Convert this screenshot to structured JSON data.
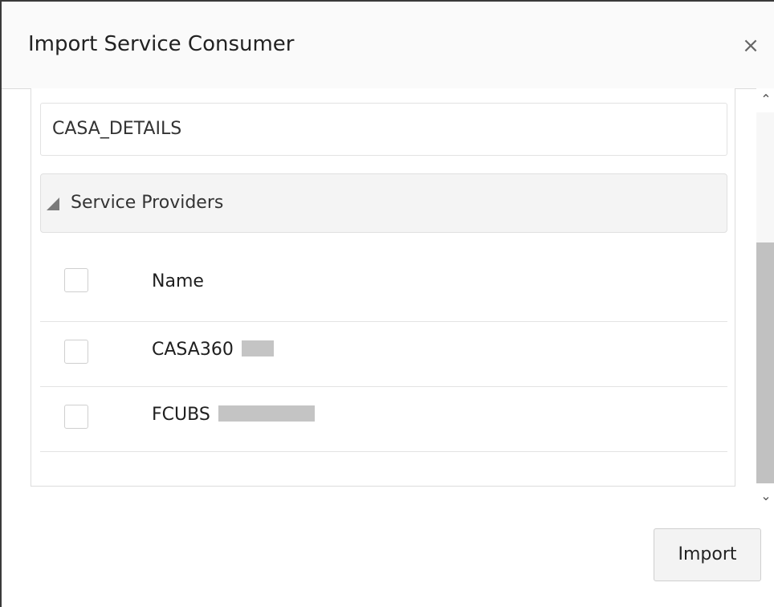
{
  "dialog": {
    "title": "Import Service Consumer",
    "close_icon": "close-icon",
    "close_glyph": "×"
  },
  "consumer": {
    "name": "CASA_DETAILS"
  },
  "section": {
    "label": "Service Providers",
    "icon": "collapse-triangle-icon"
  },
  "table": {
    "header": "Name",
    "rows": [
      {
        "name": "CASA360"
      },
      {
        "name": "FCUBS"
      }
    ]
  },
  "scrollbar": {
    "up_glyph": "⌃",
    "down_glyph": "⌄"
  },
  "footer": {
    "import_label": "Import"
  },
  "colors": {
    "header_bg": "#fafafa",
    "section_bg": "#f4f4f4",
    "scroll_thumb": "#c1c1c1",
    "redaction": "#c4c4c4"
  }
}
